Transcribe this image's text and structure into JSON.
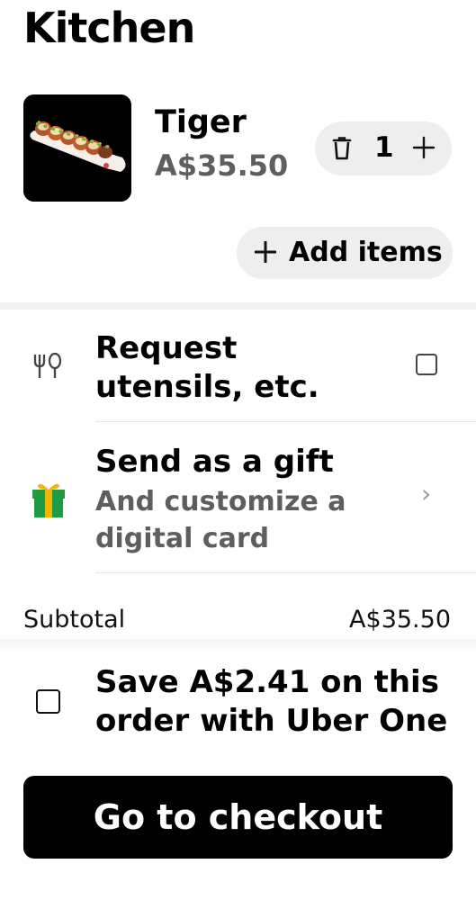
{
  "store": {
    "title": "Kitchen"
  },
  "cart_item": {
    "name": "Tiger",
    "price": "A$35.50",
    "quantity": "1",
    "image_icon": "sushi-roll-image"
  },
  "actions": {
    "add_items_label": "Add items"
  },
  "options": {
    "utensils": {
      "title": "Request utensils, etc.",
      "checked": false,
      "icon": "utensils-icon"
    },
    "gift": {
      "title": "Send as a gift",
      "subtitle": "And customize a digital card",
      "icon": "gift-icon"
    }
  },
  "summary": {
    "subtotal_label": "Subtotal",
    "subtotal_value": "A$35.50"
  },
  "uber_one": {
    "text": "Save A$2.41 on this order with Uber One",
    "checked": false
  },
  "checkout": {
    "label": "Go to checkout"
  },
  "colors": {
    "gift_green": "#1f9a45",
    "gift_yellow": "#f2b705",
    "muted_text": "#5e5e5e"
  }
}
